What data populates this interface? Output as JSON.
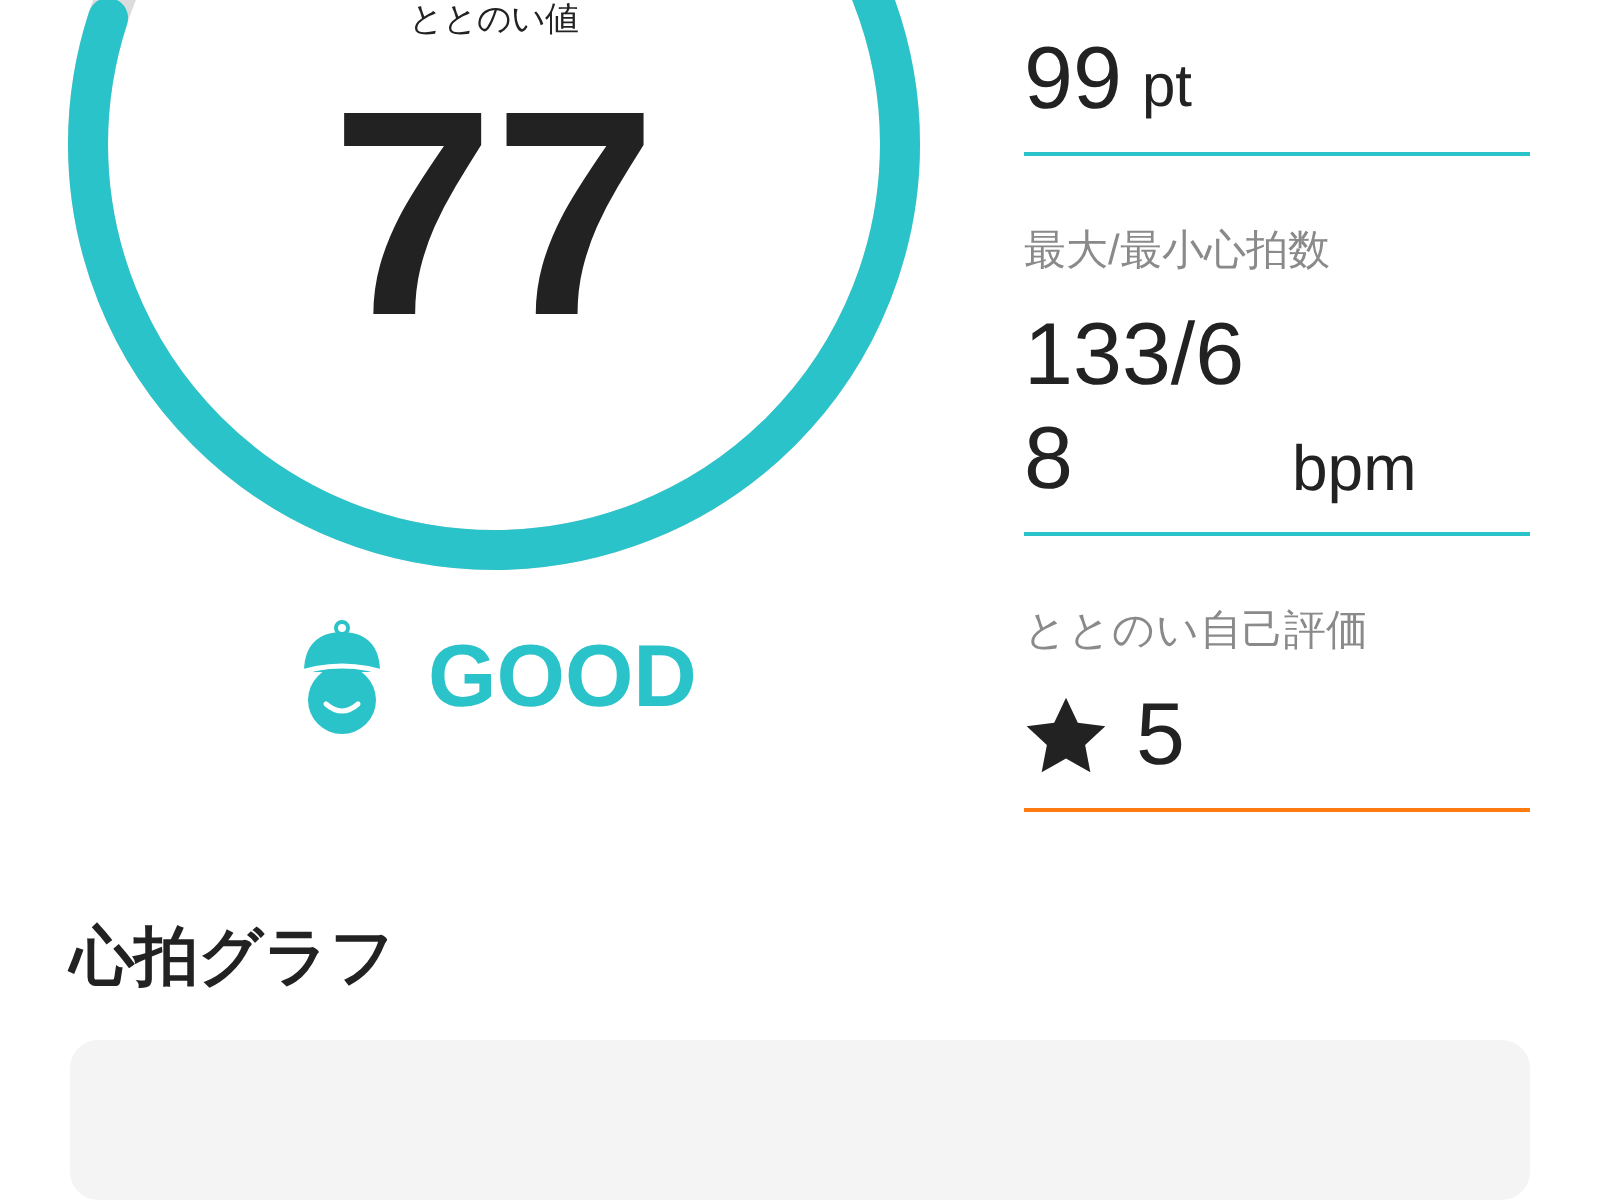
{
  "gauge": {
    "label": "ととのい値",
    "value": "77"
  },
  "status": {
    "text": "GOOD"
  },
  "metrics": [
    {
      "kind": "value",
      "value": "99",
      "unit": "pt",
      "color": "#2ac3c9"
    },
    {
      "kind": "value",
      "label": "最大/最小心拍数",
      "value": "133/68",
      "unit": "bpm",
      "color": "#2ac3c9"
    },
    {
      "kind": "rating",
      "label": "ととのい自己評価",
      "value": "5",
      "color": "#ff7a0f"
    }
  ],
  "heart_rate_graph": {
    "title": "心拍グラフ"
  }
}
